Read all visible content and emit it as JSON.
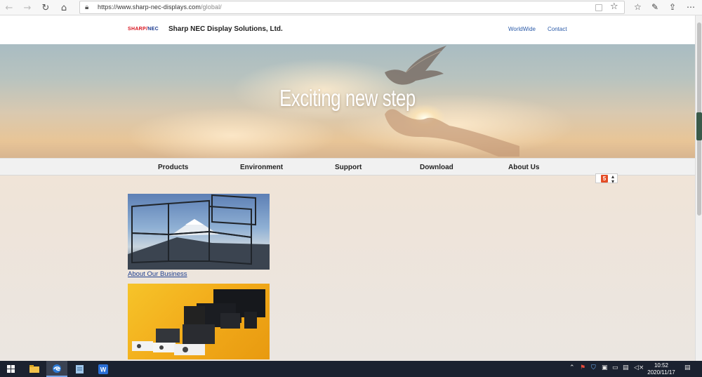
{
  "browser": {
    "url_host": "https://www.sharp-nec-displays.com",
    "url_path": "/global/"
  },
  "site": {
    "logo_sharp": "SHARP",
    "logo_slash": "/",
    "logo_nec": "NEC",
    "company": "Sharp NEC Display Solutions, Ltd.",
    "top_links": [
      "WorldWide",
      "Contact"
    ]
  },
  "hero": {
    "title": "Exciting new step"
  },
  "nav": {
    "items": [
      "Products",
      "Environment",
      "Support",
      "Download",
      "About Us"
    ]
  },
  "language_selector": {
    "badge": "5",
    "arrows": "▴▾"
  },
  "content": {
    "card1_link": "About Our Business"
  },
  "taskbar": {
    "time": "10:52",
    "date": "2020/11/17"
  },
  "colors": {
    "accent_link": "#2a5aa8",
    "sharp_red": "#d8141f",
    "nec_blue": "#1c3a8f",
    "taskbar": "#1b2230"
  }
}
